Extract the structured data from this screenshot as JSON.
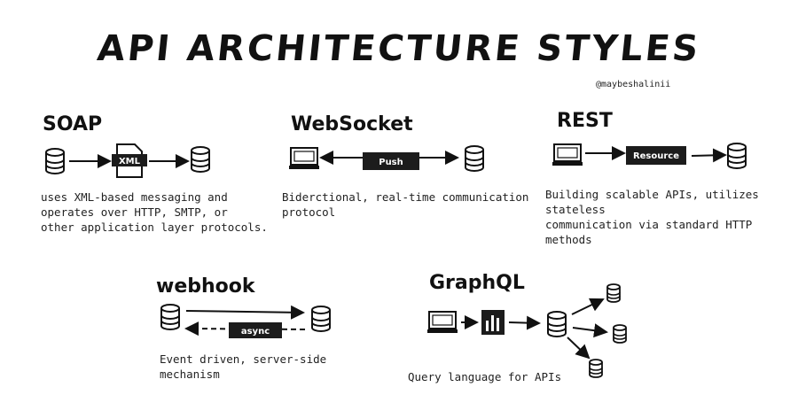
{
  "title": "API ARCHITECTURE STYLES",
  "handle": "@maybeshalinii",
  "colors": {
    "ink": "#111111",
    "box": "#1c1c1c",
    "paper": "#ffffff"
  },
  "styles": {
    "soap": {
      "name": "SOAP",
      "label": "XML",
      "desc_lines": [
        "uses XML-based messaging and",
        "operates over HTTP, SMTP, or",
        "other application layer protocols."
      ]
    },
    "websocket": {
      "name": "WebSocket",
      "label": "Push",
      "desc_lines": [
        "Biderctional, real-time communication",
        "protocol"
      ]
    },
    "rest": {
      "name": "REST",
      "label": "Resource",
      "desc_lines": [
        "Building scalable APIs, utilizes stateless",
        "communication via standard HTTP methods"
      ]
    },
    "webhook": {
      "name": "webhook",
      "label": "async",
      "desc_lines": [
        "Event driven, server-side",
        "mechanism"
      ]
    },
    "graphql": {
      "name": "GraphQL",
      "desc_lines": [
        "Query language for APIs"
      ]
    }
  },
  "icons": [
    "database-icon",
    "computer-icon",
    "xml-document-icon",
    "graph-icon",
    "arrow-icon"
  ]
}
